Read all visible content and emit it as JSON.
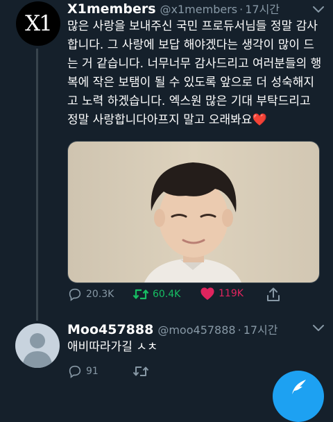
{
  "tweets": [
    {
      "name": "X1members",
      "handle": "@x1members",
      "separator": "·",
      "time": "17시간",
      "text": "많은 사랑을 보내주신 국민 프로듀서님들 정말 감사합니다. 그 사랑에 보답 해야겠다는 생각이 많이 드는 거 같습니다. 너무너무 감사드리고 여러분들의 행복에 작은 보탬이 될 수 있도록 앞으로 더 성숙해지고 노력 하겠습니다. 엑스원 많은 기대 부탁드리고 정말 사랑합니다아프지 말고 오래봐요❤️",
      "avatar_logo": "X1",
      "counts": {
        "reply": "20.3K",
        "retweet": "60.4K",
        "like": "119K"
      }
    },
    {
      "name": "Moo457888",
      "handle": "@moo457888",
      "separator": "·",
      "time": "17시간",
      "text": "애비따라가길 ㅅㅊ",
      "counts": {
        "reply": "91"
      }
    }
  ],
  "icons": {
    "reply": "speech-bubble-icon",
    "retweet": "retweet-icon",
    "like": "heart-icon",
    "share": "share-icon",
    "more": "chevron-down-icon",
    "compose": "compose-feather-icon"
  },
  "colors": {
    "background": "#15202b",
    "secondary_text": "#8899a6",
    "retweet_active": "#17bf63",
    "like_active": "#e0245e",
    "accent": "#1da1f2"
  }
}
